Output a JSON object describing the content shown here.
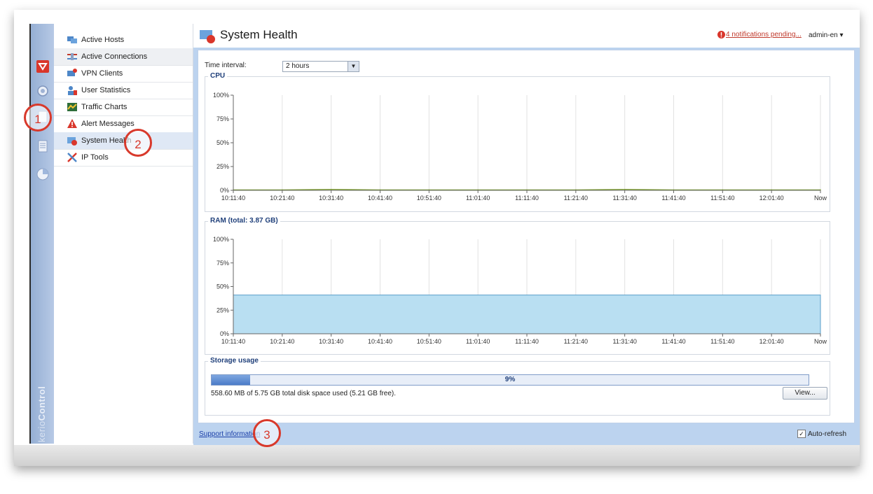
{
  "app": {
    "brand_a": "kerio",
    "brand_b": "Control"
  },
  "sidebar": {
    "items": [
      {
        "label": "Active Hosts",
        "icon": "hosts-icon"
      },
      {
        "label": "Active Connections",
        "icon": "connections-icon"
      },
      {
        "label": "VPN Clients",
        "icon": "vpn-clients-icon"
      },
      {
        "label": "User Statistics",
        "icon": "user-statistics-icon"
      },
      {
        "label": "Traffic Charts",
        "icon": "traffic-charts-icon"
      },
      {
        "label": "Alert Messages",
        "icon": "alert-icon"
      },
      {
        "label": "System Health",
        "icon": "system-health-icon"
      },
      {
        "label": "IP Tools",
        "icon": "ip-tools-icon"
      }
    ]
  },
  "header": {
    "title": "System Health",
    "notifications": "4 notifications pending...",
    "user": "admin-en"
  },
  "controls": {
    "time_interval_label": "Time interval:",
    "time_interval_value": "2 hours"
  },
  "cpu": {
    "label": "CPU",
    "chart_data": {
      "type": "line",
      "title": "CPU",
      "x": [
        "10:11:40",
        "10:21:40",
        "10:31:40",
        "10:41:40",
        "10:51:40",
        "11:01:40",
        "11:11:40",
        "11:21:40",
        "11:31:40",
        "11:41:40",
        "11:51:40",
        "12:01:40",
        "Now"
      ],
      "y_ticks": [
        "100%",
        "75%",
        "50%",
        "25%",
        "0%"
      ],
      "ylim": [
        0,
        100
      ],
      "series": [
        {
          "values": [
            0.5,
            0.5,
            1,
            0.5,
            0.5,
            0.5,
            0.5,
            0.5,
            1,
            0.5,
            0.5,
            0.5,
            0.5
          ]
        }
      ],
      "color": "#7fa12f"
    }
  },
  "ram": {
    "label": "RAM (total: 3.87 GB)",
    "chart_data": {
      "type": "area",
      "title": "RAM (total: 3.87 GB)",
      "x": [
        "10:11:40",
        "10:21:40",
        "10:31:40",
        "10:41:40",
        "10:51:40",
        "11:01:40",
        "11:11:40",
        "11:21:40",
        "11:31:40",
        "11:41:40",
        "11:51:40",
        "12:01:40",
        "Now"
      ],
      "y_ticks": [
        "100%",
        "75%",
        "50%",
        "25%",
        "0%"
      ],
      "ylim": [
        0,
        100
      ],
      "series": [
        {
          "values": [
            41,
            41,
            41,
            41,
            41,
            41,
            41,
            41,
            41,
            41,
            41,
            41,
            41
          ]
        }
      ],
      "color": "#b9dff2"
    }
  },
  "storage": {
    "label": "Storage usage",
    "percent_text": "9%",
    "percent": 0.064,
    "detail": "558.60 MB of 5.75 GB total disk space used (5.21 GB free).",
    "view_button": "View..."
  },
  "footer": {
    "support_link": "Support information",
    "auto_refresh": "Auto-refresh",
    "auto_refresh_checked": "✓"
  },
  "annotations": {
    "m1": "1",
    "m2": "2",
    "m3": "3"
  }
}
